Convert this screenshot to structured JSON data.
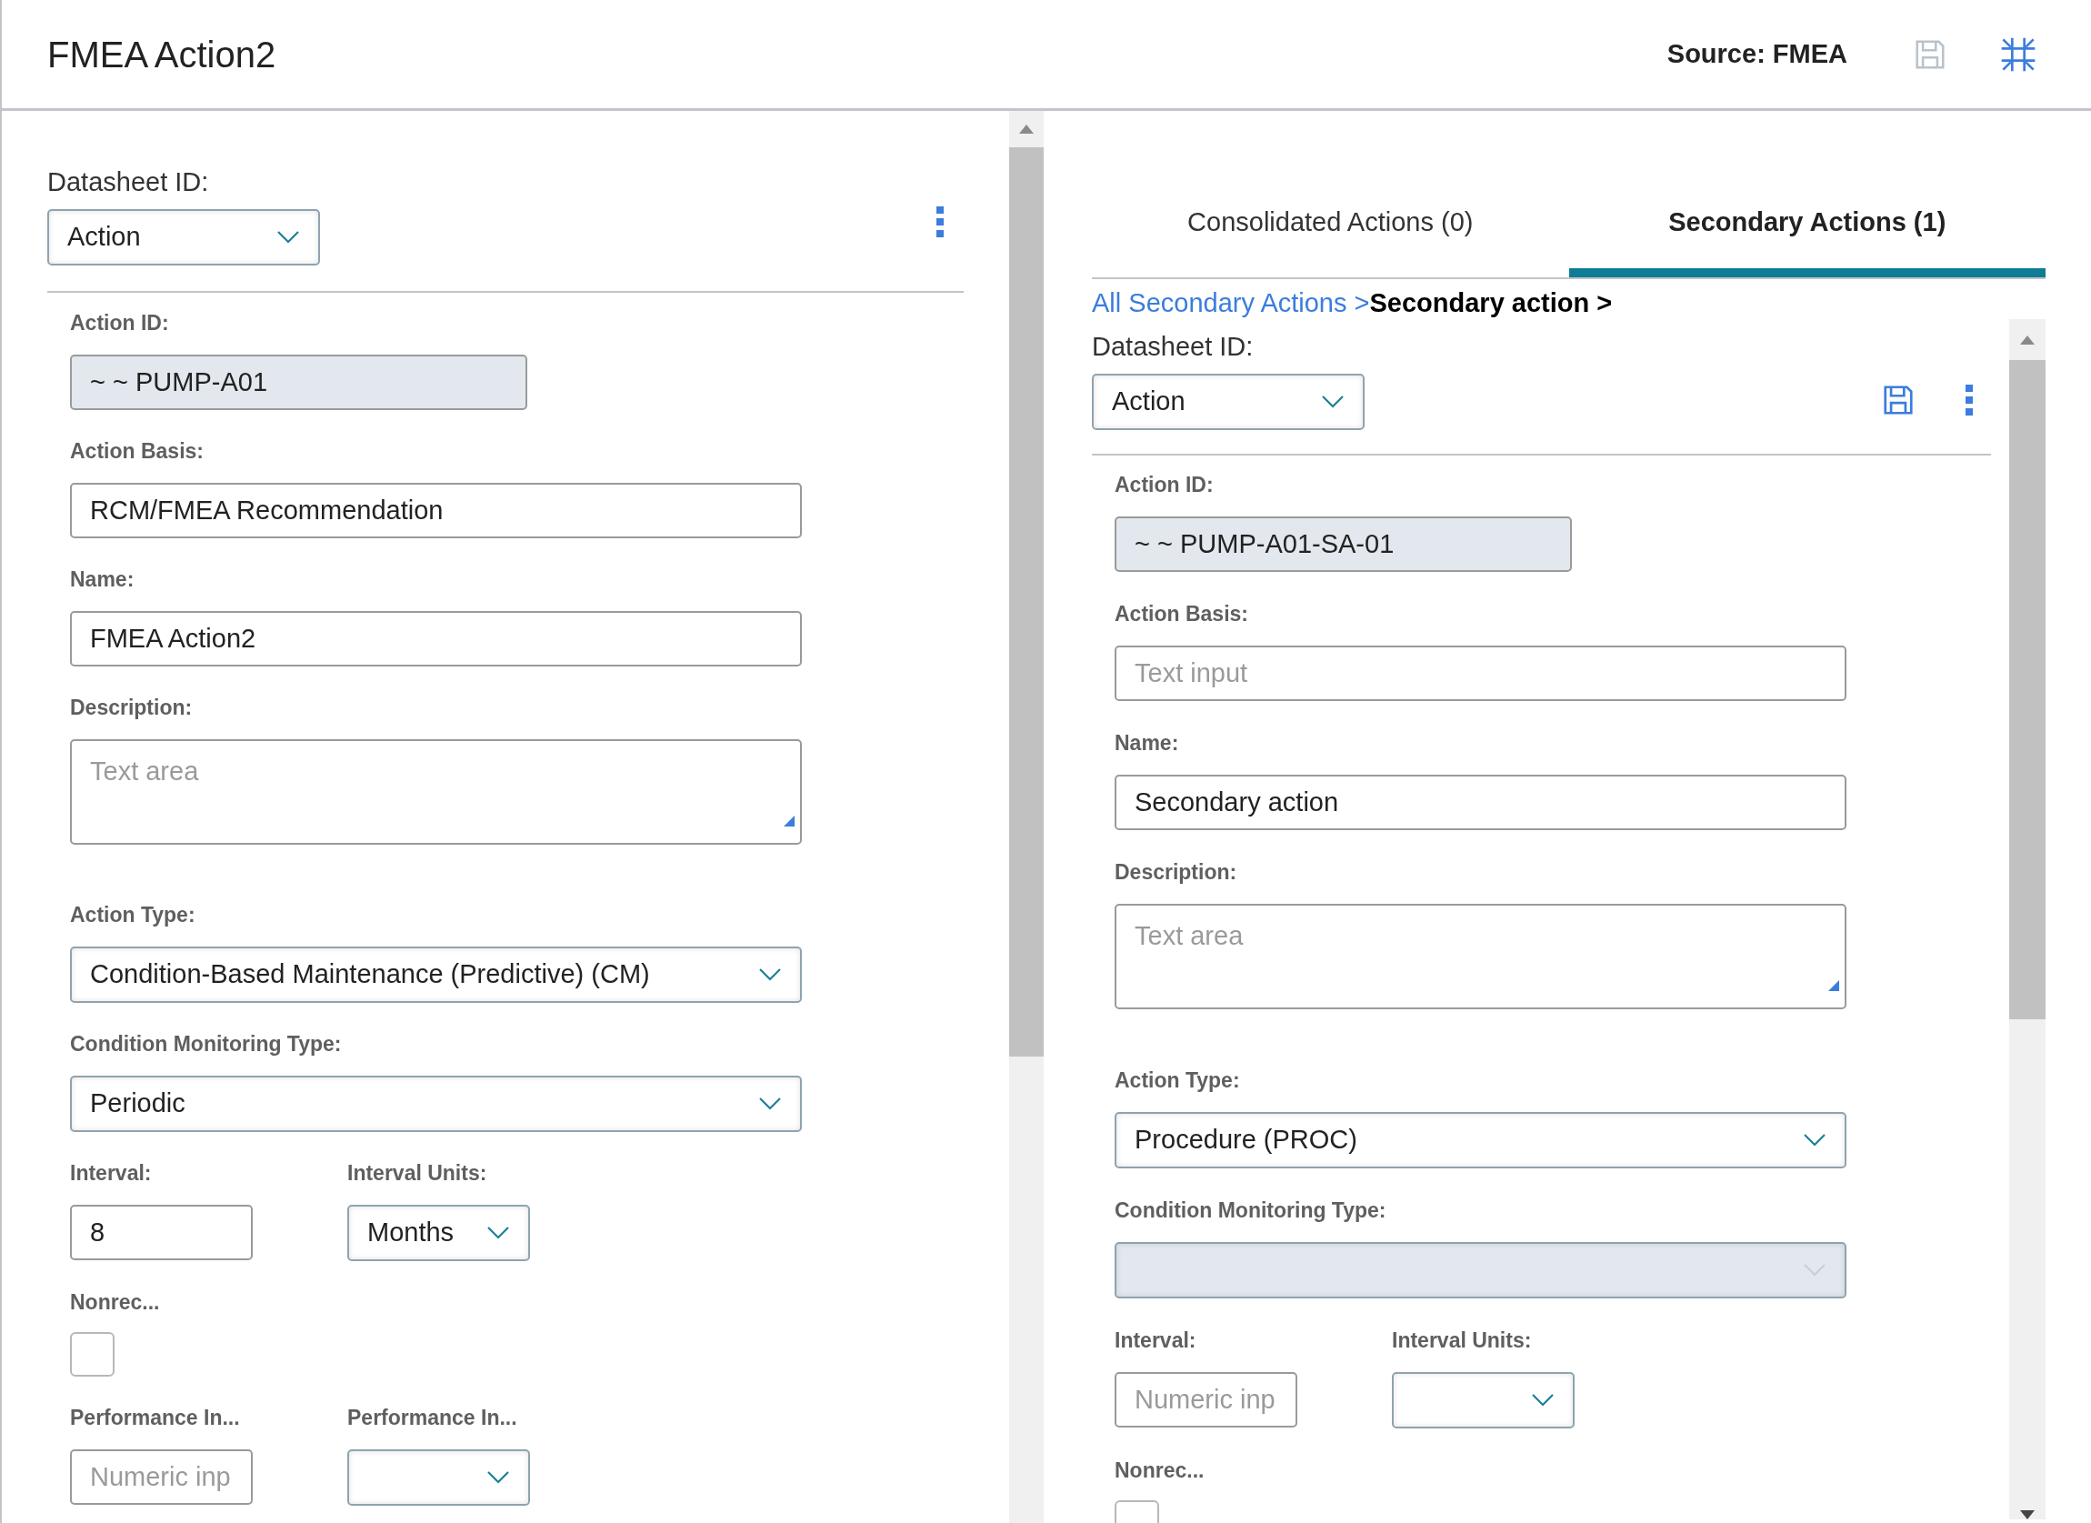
{
  "header": {
    "title": "FMEA Action2",
    "source": "Source: FMEA"
  },
  "left": {
    "datasheet_label": "Datasheet ID:",
    "datasheet_value": "Action",
    "rows": [
      [
        {
          "label": "Action ID:",
          "kind": "text",
          "value": "~ ~ PUMP-A01",
          "readonly": true,
          "disabled": false
        }
      ],
      [
        {
          "label": "Action Basis:",
          "kind": "text",
          "value": "RCM/FMEA Recommendation",
          "readonly": false,
          "disabled": false
        }
      ],
      [
        {
          "label": "Name:",
          "kind": "text",
          "value": "FMEA Action2",
          "readonly": false,
          "disabled": false
        }
      ],
      [
        {
          "label": "Description:",
          "kind": "textarea",
          "placeholder": "Text area",
          "readonly": false,
          "disabled": false
        }
      ],
      [
        {
          "label": "Action Type:",
          "kind": "select",
          "value": "Condition-Based Maintenance (Predictive) (CM)",
          "readonly": false,
          "disabled": false
        }
      ],
      [
        {
          "label": "Condition Monitoring Type:",
          "kind": "select",
          "value": "Periodic",
          "readonly": false,
          "disabled": false
        }
      ],
      [
        {
          "label": "Interval:",
          "kind": "text",
          "value": "8",
          "readonly": false,
          "disabled": false
        },
        {
          "label": "Interval Units:",
          "kind": "select",
          "value": "Months",
          "readonly": false,
          "disabled": false
        }
      ],
      [
        {
          "label": "Nonrec...",
          "kind": "checkbox",
          "checked": false,
          "readonly": false,
          "disabled": false
        }
      ],
      [
        {
          "label": "Performance In...",
          "kind": "text",
          "placeholder": "Numeric inp",
          "readonly": false,
          "disabled": false
        },
        {
          "label": "Performance In...",
          "kind": "select",
          "readonly": false,
          "disabled": false
        }
      ]
    ]
  },
  "right": {
    "tabs": [
      {
        "label": "Consolidated Actions (0)",
        "selected": false
      },
      {
        "label": "Secondary Actions (1)",
        "selected": true
      }
    ],
    "breadcrumb": [
      {
        "label": "All Secondary Actions >",
        "kind": "link"
      },
      {
        "label": "Secondary action >",
        "kind": "current"
      }
    ],
    "datasheet_label": "Datasheet ID:",
    "datasheet_value": "Action",
    "rows": [
      [
        {
          "label": "Action ID:",
          "kind": "text",
          "value": "~ ~ PUMP-A01-SA-01",
          "readonly": true,
          "disabled": false
        }
      ],
      [
        {
          "label": "Action Basis:",
          "kind": "text",
          "placeholder": "Text input",
          "readonly": false,
          "disabled": false
        }
      ],
      [
        {
          "label": "Name:",
          "kind": "text",
          "value": "Secondary action",
          "readonly": false,
          "disabled": false
        }
      ],
      [
        {
          "label": "Description:",
          "kind": "textarea",
          "placeholder": "Text area",
          "readonly": false,
          "disabled": false
        }
      ],
      [
        {
          "label": "Action Type:",
          "kind": "select",
          "value": "Procedure (PROC)",
          "readonly": false,
          "disabled": false
        }
      ],
      [
        {
          "label": "Condition Monitoring Type:",
          "kind": "select",
          "readonly": false,
          "disabled": true
        }
      ],
      [
        {
          "label": "Interval:",
          "kind": "text",
          "placeholder": "Numeric inp",
          "readonly": false,
          "disabled": false
        },
        {
          "label": "Interval Units:",
          "kind": "select",
          "readonly": false,
          "disabled": false
        }
      ],
      [
        {
          "label": "Nonrec...",
          "kind": "checkbox",
          "checked": false,
          "readonly": false,
          "disabled": false
        }
      ]
    ]
  }
}
